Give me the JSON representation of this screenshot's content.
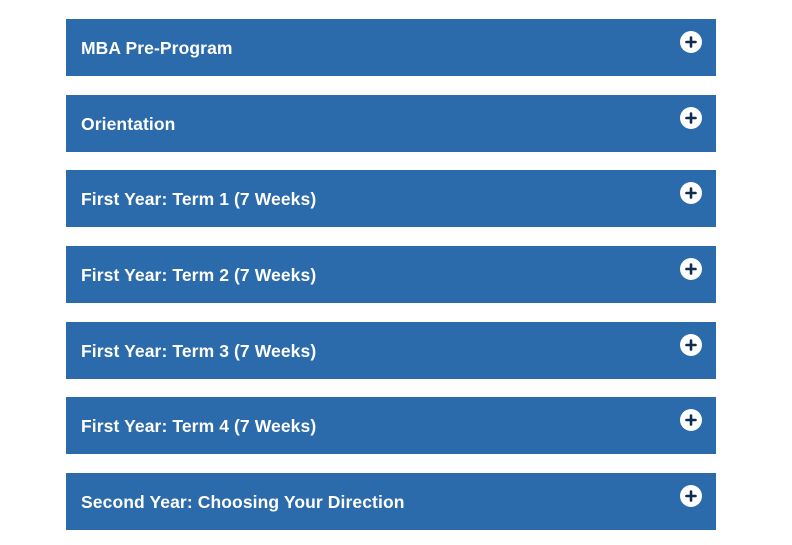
{
  "accordion": {
    "items": [
      {
        "label": "MBA Pre-Program",
        "icon": "plus-circle-icon",
        "expanded": false
      },
      {
        "label": "Orientation",
        "icon": "plus-circle-icon",
        "expanded": false
      },
      {
        "label": "First Year: Term 1 (7 Weeks)",
        "icon": "plus-circle-icon",
        "expanded": false
      },
      {
        "label": "First Year: Term 2 (7 Weeks)",
        "icon": "plus-circle-icon",
        "expanded": false
      },
      {
        "label": "First Year: Term 3 (7 Weeks)",
        "icon": "plus-circle-icon",
        "expanded": false
      },
      {
        "label": "First Year: Term 4 (7 Weeks)",
        "icon": "plus-circle-icon",
        "expanded": false
      },
      {
        "label": "Second Year: Choosing Your Direction",
        "icon": "plus-circle-icon",
        "expanded": false
      }
    ]
  },
  "colors": {
    "panel_background": "#2b6aab",
    "panel_text": "#ffffff",
    "icon_background": "#ffffff",
    "icon_glyph": "#0f2d4f",
    "page_background": "#ffffff"
  }
}
